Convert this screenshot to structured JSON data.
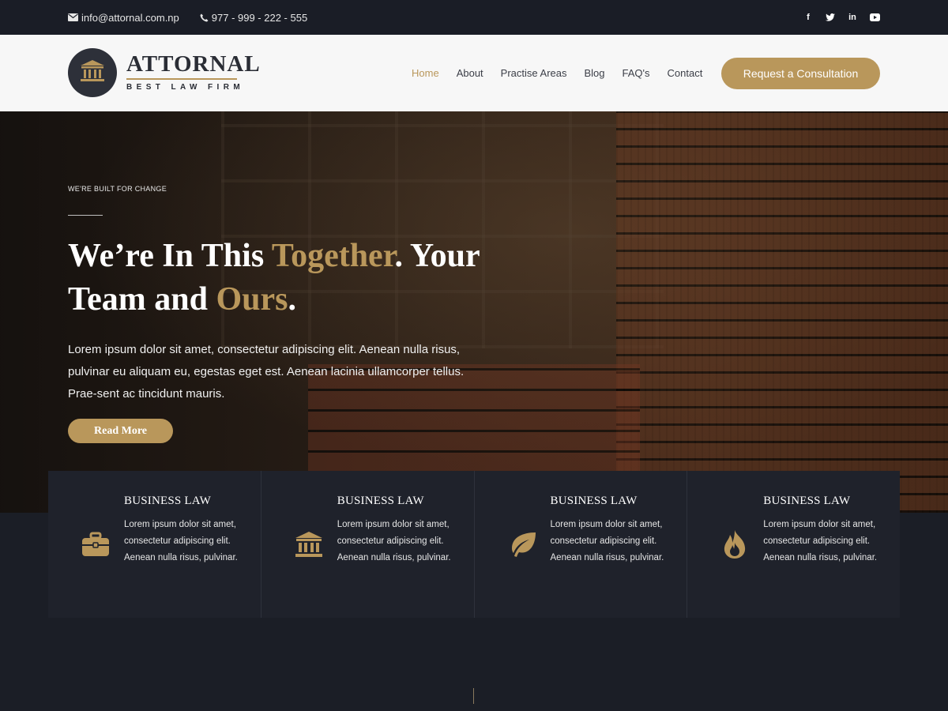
{
  "topbar": {
    "email": "info@attornal.com.np",
    "phone": "977 - 999 - 222 - 555",
    "social": [
      {
        "icon": "facebook-icon",
        "glyph": "f"
      },
      {
        "icon": "twitter-icon",
        "glyph": "t"
      },
      {
        "icon": "linkedin-icon",
        "glyph": "in"
      },
      {
        "icon": "youtube-icon",
        "glyph": "▶"
      }
    ]
  },
  "header": {
    "brand_name": "ATTORNAL",
    "brand_tagline": "BEST LAW FIRM",
    "nav": [
      "Home",
      "About",
      "Practise Areas",
      "Blog",
      "FAQ's",
      "Contact"
    ],
    "active_nav": "Home",
    "cta_label": "Request a Consultation"
  },
  "hero": {
    "eyebrow": "WE'RE BUILT FOR CHANGE",
    "headline_part1": "We’re In This ",
    "headline_gold1": "Together",
    "headline_part2": ". Your",
    "headline_part3": "Team and ",
    "headline_gold2": "Ours",
    "headline_part4": ".",
    "text": "Lorem ipsum dolor sit amet, consectetur adipiscing elit. Aenean nulla risus, pulvinar eu aliquam eu, egestas eget est. Aenean lacinia ullamcorper tellus. Prae-sent ac tincidunt mauris.",
    "button_label": "Read More"
  },
  "features": [
    {
      "icon": "briefcase-icon",
      "title": "BUSINESS LAW",
      "text": "Lorem ipsum dolor sit amet, consectetur adipiscing elit. Aenean nulla risus, pulvinar."
    },
    {
      "icon": "courthouse-icon",
      "title": "BUSINESS LAW",
      "text": "Lorem ipsum dolor sit amet, consectetur adipiscing elit. Aenean nulla risus, pulvinar."
    },
    {
      "icon": "leaf-icon",
      "title": "BUSINESS LAW",
      "text": "Lorem ipsum dolor sit amet, consectetur adipiscing elit. Aenean nulla risus, pulvinar."
    },
    {
      "icon": "fire-icon",
      "title": "BUSINESS LAW",
      "text": "Lorem ipsum dolor sit amet, consectetur adipiscing elit. Aenean nulla risus, pulvinar."
    }
  ],
  "colors": {
    "accent": "#b9975b",
    "dark": "#1b1e26",
    "header_bg": "#f7f7f7"
  }
}
